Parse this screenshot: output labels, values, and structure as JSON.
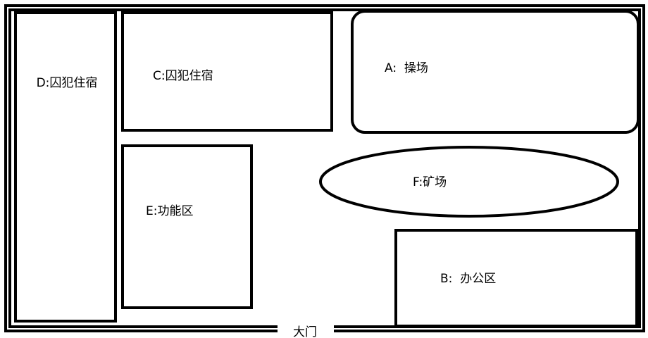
{
  "areas": {
    "d": {
      "label": "D:囚犯住宿"
    },
    "c": {
      "label": "C:囚犯住宿"
    },
    "a": {
      "label": "A:  操场"
    },
    "e": {
      "label": "E:功能区"
    },
    "f": {
      "label": "F:矿场"
    },
    "b": {
      "label": "B:  办公区"
    }
  },
  "gate": {
    "label": "大门"
  },
  "colors": {
    "stroke": "#000000",
    "background": "#ffffff"
  }
}
